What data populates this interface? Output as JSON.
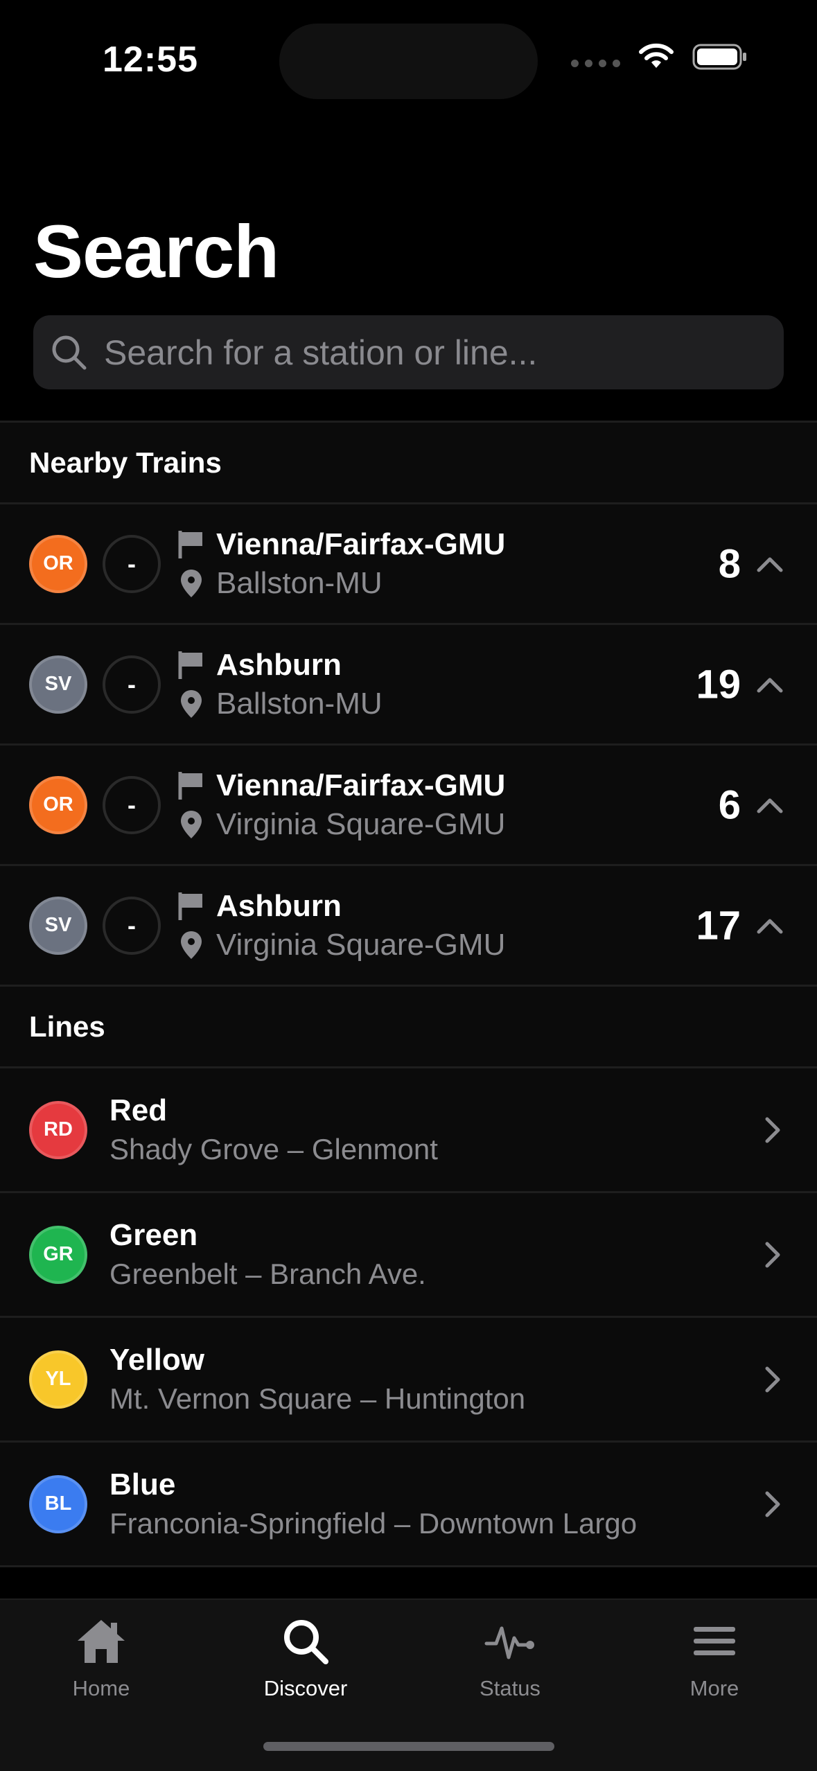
{
  "status_bar": {
    "time": "12:55"
  },
  "page": {
    "title": "Search"
  },
  "search": {
    "placeholder": "Search for a station or line..."
  },
  "colors": {
    "OR": "#f36d1e",
    "SV": "#6b7280",
    "RD": "#e53a3f",
    "GR": "#1fb550",
    "YL": "#f8c72a",
    "BL": "#3b7cf0"
  },
  "nearby": {
    "header": "Nearby Trains",
    "trains": [
      {
        "line": "OR",
        "cars": "-",
        "destination": "Vienna/Fairfax-GMU",
        "location": "Ballston-MU",
        "minutes": "8"
      },
      {
        "line": "SV",
        "cars": "-",
        "destination": "Ashburn",
        "location": "Ballston-MU",
        "minutes": "19"
      },
      {
        "line": "OR",
        "cars": "-",
        "destination": "Vienna/Fairfax-GMU",
        "location": "Virginia Square-GMU",
        "minutes": "6"
      },
      {
        "line": "SV",
        "cars": "-",
        "destination": "Ashburn",
        "location": "Virginia Square-GMU",
        "minutes": "17"
      }
    ]
  },
  "lines": {
    "header": "Lines",
    "items": [
      {
        "code": "RD",
        "name": "Red",
        "route": "Shady Grove – Glenmont"
      },
      {
        "code": "GR",
        "name": "Green",
        "route": "Greenbelt – Branch Ave."
      },
      {
        "code": "YL",
        "name": "Yellow",
        "route": "Mt. Vernon Square – Huntington"
      },
      {
        "code": "BL",
        "name": "Blue",
        "route": "Franconia-Springfield – Downtown Largo"
      }
    ]
  },
  "tabs": [
    {
      "label": "Home",
      "icon": "house-icon",
      "active": false
    },
    {
      "label": "Discover",
      "icon": "magnifier-icon",
      "active": true
    },
    {
      "label": "Status",
      "icon": "waveform-icon",
      "active": false
    },
    {
      "label": "More",
      "icon": "hamburger-menu-icon",
      "active": false
    }
  ]
}
